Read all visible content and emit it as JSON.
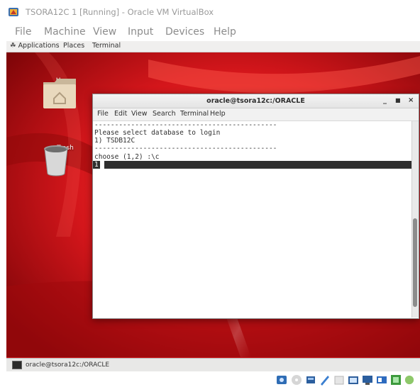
{
  "window": {
    "title": "TSORA12C 1 [Running] - Oracle VM VirtualBox"
  },
  "vbox_menu": [
    "File",
    "Machine",
    "View",
    "Input",
    "Devices",
    "Help"
  ],
  "guest_topbar": {
    "applications": "Applications",
    "places": "Places",
    "terminal": "Terminal"
  },
  "desktop_icons": [
    {
      "label": "Home"
    },
    {
      "label": "Trash"
    }
  ],
  "terminal": {
    "title": "oracle@tsora12c:/ORACLE",
    "menu": [
      "File",
      "Edit",
      "View",
      "Search",
      "Terminal",
      "Help"
    ],
    "lines": [
      "---------------------------------------------",
      "Please select database to login",
      "1) TSDB12C",
      "---------------------------------------------",
      "choose (1,2) :\\c"
    ],
    "input_line": "1"
  },
  "taskbar": {
    "item": "oracle@tsora12c:/ORACLE"
  },
  "colors": {
    "desktop_red": "#c8161a",
    "terminal_fg": "#2e2e2e"
  }
}
